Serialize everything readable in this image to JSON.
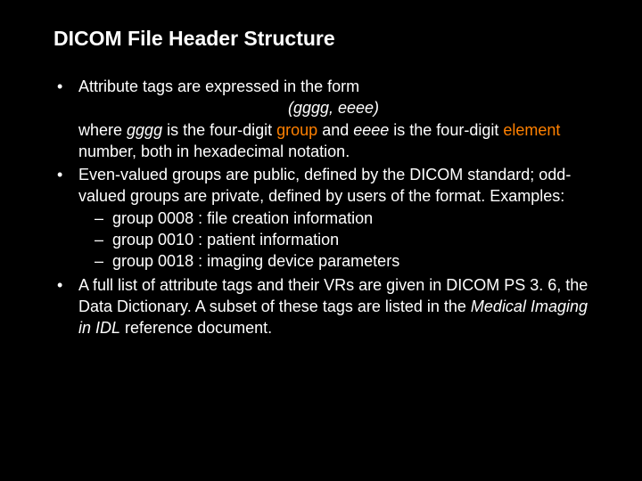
{
  "title": "DICOM File Header Structure",
  "b1": {
    "line1": "Attribute tags are expressed in the form",
    "tagform": "(gggg, eeee)",
    "line2a": "where ",
    "gggg": "gggg",
    "line2b": " is the four-digit ",
    "kw_group": "group",
    "line2c": " and ",
    "eeee": "eeee",
    "line2d": " is the four-digit ",
    "kw_element": "element",
    "line2e": " number, both in hexadecimal notation."
  },
  "b2": {
    "text": "Even-valued groups are public, defined by the DICOM standard; odd-valued groups are private, defined by users of the format. Examples:",
    "sub1": "group 0008 : file creation information",
    "sub2": "group 0010 : patient information",
    "sub3": "group 0018 : imaging device parameters"
  },
  "b3": {
    "t1": "A full list of attribute tags and their VRs are given in DICOM PS 3. 6, the Data Dictionary. A subset of these tags are listed in the ",
    "ital": "Medical Imaging in IDL",
    "t2": " reference document."
  }
}
